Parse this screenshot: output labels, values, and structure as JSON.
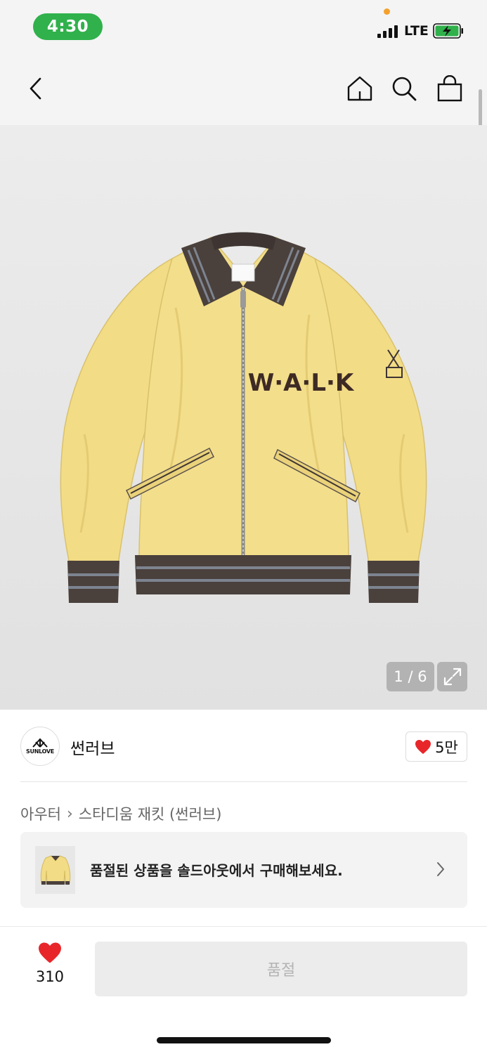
{
  "status_bar": {
    "time": "4:30",
    "network": "LTE",
    "icons": [
      "signal-icon",
      "battery-charging-icon"
    ],
    "battery_color": "#30b14b"
  },
  "header": {
    "icons": [
      "back-icon",
      "home-icon",
      "search-icon",
      "shopping-bag-icon"
    ]
  },
  "product_image": {
    "pager": "1 / 6",
    "expand_icon": "expand-icon",
    "jacket_lettering": "W·A·L·K"
  },
  "brand": {
    "logo_text": "SUNLOVE",
    "name": "썬러브",
    "like_count": "5만",
    "like_icon": "heart-icon"
  },
  "breadcrumb": {
    "category": "아우터",
    "product": "스타디움 재킷 (썬러브)"
  },
  "soldout_banner": {
    "text": "품절된 상품을 솔드아웃에서 구매해보세요.",
    "chevron_icon": "chevron-right-icon"
  },
  "bottom_bar": {
    "wish_count": "310",
    "soldout_label": "품절"
  },
  "colors": {
    "heart": "#e8262a",
    "jacket": "#f2dc86",
    "trim": "#3e3533",
    "disabled_button": "#ececec"
  }
}
